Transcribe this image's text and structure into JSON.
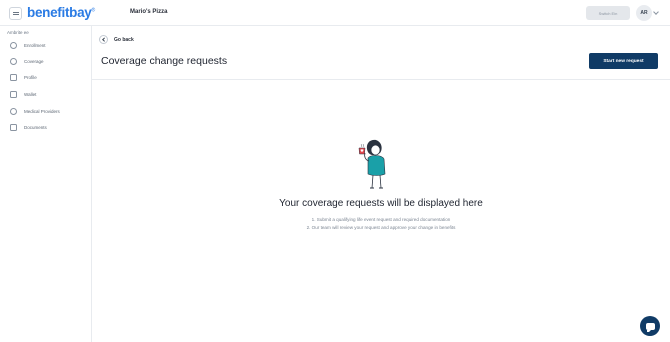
{
  "header": {
    "logo_text": "benefitbay",
    "logo_mark": "®",
    "company_name": "Mario's Pizza",
    "switch_label": "Switch Ein",
    "avatar_initials": "AR"
  },
  "sidebar": {
    "heading": "Ambrite ee",
    "items": [
      {
        "label": "Enrollment",
        "icon": "shield-icon"
      },
      {
        "label": "Coverage",
        "icon": "umbrella-icon"
      },
      {
        "label": "Profile",
        "icon": "profile-card-icon"
      },
      {
        "label": "Wallet",
        "icon": "wallet-icon"
      },
      {
        "label": "Medical Providers",
        "icon": "stethoscope-icon"
      },
      {
        "label": "Documents",
        "icon": "document-icon"
      }
    ]
  },
  "main": {
    "go_back_label": "Go back",
    "title": "Coverage change requests",
    "start_button_label": "Start new request",
    "empty_title": "Your coverage requests will be displayed here",
    "steps": [
      "1. Submit a qualifying life event request and required documentation",
      "2. Our team will review your request and approve your change in benefits"
    ]
  },
  "colors": {
    "brand_blue": "#2a7be4",
    "primary_navy": "#103b66",
    "illustration_teal": "#1aa0a8",
    "illustration_red": "#e2474f"
  }
}
